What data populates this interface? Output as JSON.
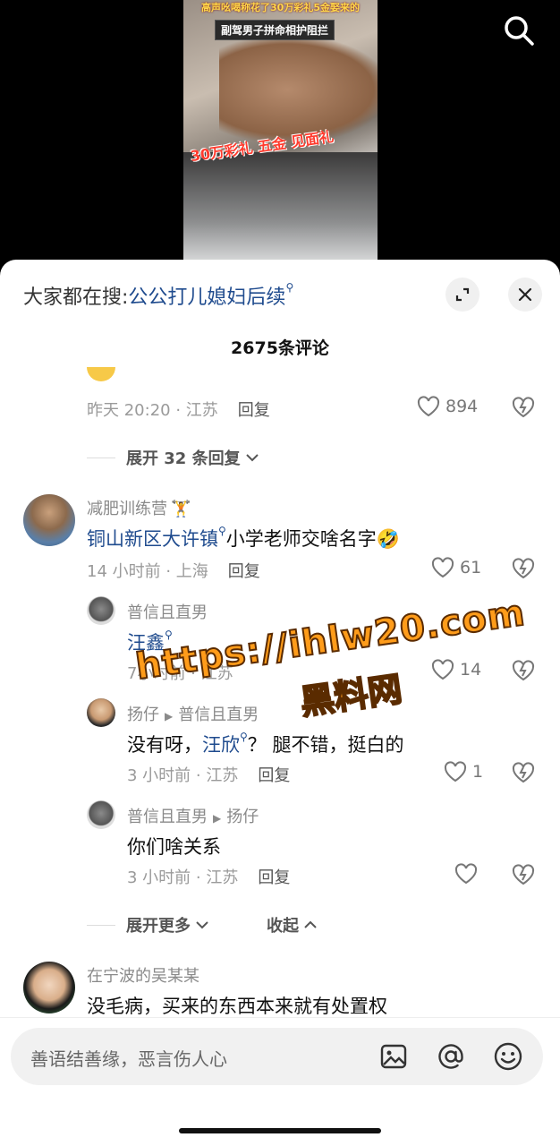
{
  "video": {
    "caption_top": "高声吆喝称花了30万彩礼5金娶来的",
    "caption_box": "副驾男子拼命相护阻拦",
    "caption_mid": "30万彩礼 五金 见面礼"
  },
  "sheet": {
    "hot_search_prefix": "大家都在搜:",
    "hot_search_keyword": "公公打儿媳妇后续",
    "comment_count": "2675条评论"
  },
  "top_comment_tail": {
    "meta": "昨天 20:20 · 江苏",
    "reply": "回复",
    "likes": "894",
    "expand": "展开 32 条回复"
  },
  "comments": [
    {
      "author": "减肥训练营",
      "text_kw": "铜山新区大许镇",
      "text_rest": "小学老师交啥名字",
      "meta": "14 小时前 · 上海",
      "reply": "回复",
      "likes": "61"
    }
  ],
  "replies": [
    {
      "author": "普信且直男",
      "text_kw": "汪鑫",
      "meta": "7小时前 · 江苏",
      "likes": "14"
    },
    {
      "author": "扬仔",
      "reply_to": "普信且直男",
      "text_a": "没有呀，",
      "text_kw": "汪欣",
      "text_b": "？ 腿不错，挺白的",
      "meta": "3 小时前 · 江苏",
      "reply": "回复",
      "likes": "1"
    },
    {
      "author": "普信且直男",
      "reply_to": "扬仔",
      "text": "你们啥关系",
      "meta": "3 小时前 · 江苏",
      "reply": "回复"
    }
  ],
  "thread_controls": {
    "expand_more": "展开更多",
    "collapse": "收起"
  },
  "last_comment": {
    "author": "在宁波的吴某某",
    "text": "没毛病，买来的东西本来就有处置权"
  },
  "watermark": {
    "line1": "https://ihlw20.com",
    "line2": "黑料网"
  },
  "input": {
    "placeholder": "善语结善缘，恶言伤人心"
  },
  "icons": [
    "search-icon",
    "expand-icon",
    "close-icon",
    "heart-icon",
    "dislike-icon",
    "chevron-down-icon",
    "chevron-up-icon",
    "image-icon",
    "at-icon",
    "emoji-icon"
  ]
}
